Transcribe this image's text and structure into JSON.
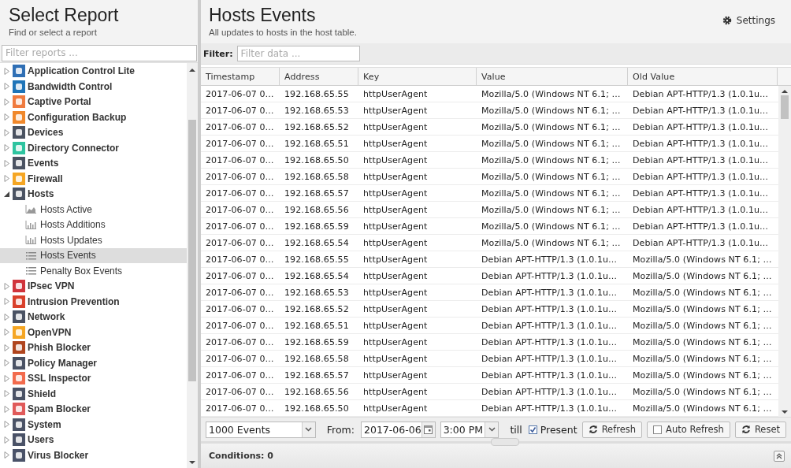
{
  "sidebar": {
    "title": "Select Report",
    "subtitle": "Find or select a report",
    "filter": {
      "placeholder": "Filter reports ..."
    },
    "tree": [
      {
        "label": "Application Control Lite",
        "color": "#2f6fb5",
        "expanded": false,
        "selected": false
      },
      {
        "label": "Bandwidth Control",
        "color": "#1e74b8",
        "expanded": false,
        "selected": false
      },
      {
        "label": "Captive Portal",
        "color": "#f07b3f",
        "expanded": false,
        "selected": false
      },
      {
        "label": "Configuration Backup",
        "color": "#f0882b",
        "expanded": false,
        "selected": false
      },
      {
        "label": "Devices",
        "color": "#4a5260",
        "expanded": false,
        "selected": false
      },
      {
        "label": "Directory Connector",
        "color": "#2ec4a0",
        "expanded": false,
        "selected": false
      },
      {
        "label": "Events",
        "color": "#4a5261",
        "expanded": false,
        "selected": false
      },
      {
        "label": "Firewall",
        "color": "#f5a623",
        "expanded": false,
        "selected": false
      },
      {
        "label": "Hosts",
        "color": "#4a5262",
        "expanded": true,
        "selected": false,
        "children": [
          {
            "label": "Hosts Active",
            "kind": "area",
            "selected": false
          },
          {
            "label": "Hosts Additions",
            "kind": "bars",
            "selected": false
          },
          {
            "label": "Hosts Updates",
            "kind": "bars",
            "selected": false
          },
          {
            "label": "Hosts Events",
            "kind": "list",
            "selected": true
          },
          {
            "label": "Penalty Box Events",
            "kind": "list",
            "selected": false
          }
        ]
      },
      {
        "label": "IPsec VPN",
        "color": "#d0343c",
        "expanded": false,
        "selected": false
      },
      {
        "label": "Intrusion Prevention",
        "color": "#d9402b",
        "expanded": false,
        "selected": false
      },
      {
        "label": "Network",
        "color": "#4a5263",
        "expanded": false,
        "selected": false
      },
      {
        "label": "OpenVPN",
        "color": "#f5a624",
        "expanded": false,
        "selected": false
      },
      {
        "label": "Phish Blocker",
        "color": "#b0451e",
        "expanded": false,
        "selected": false
      },
      {
        "label": "Policy Manager",
        "color": "#4a5264",
        "expanded": false,
        "selected": false
      },
      {
        "label": "SSL Inspector",
        "color": "#f26b4d",
        "expanded": false,
        "selected": false
      },
      {
        "label": "Shield",
        "color": "#4a5265",
        "expanded": false,
        "selected": false
      },
      {
        "label": "Spam Blocker",
        "color": "#e05a5a",
        "expanded": false,
        "selected": false
      },
      {
        "label": "System",
        "color": "#4a5266",
        "expanded": false,
        "selected": false
      },
      {
        "label": "Users",
        "color": "#4a5267",
        "expanded": false,
        "selected": false
      },
      {
        "label": "Virus Blocker",
        "color": "#4a5268",
        "expanded": false,
        "selected": false
      }
    ]
  },
  "main": {
    "title": "Hosts Events",
    "subtitle": "All updates to hosts in the host table.",
    "settings": "Settings",
    "filter": {
      "label": "Filter:",
      "placeholder": "Filter data ..."
    },
    "table": {
      "columns": [
        "Timestamp",
        "Address",
        "Key",
        "Value",
        "Old Value"
      ],
      "rows": [
        [
          "2017-06-07 0…",
          "192.168.65.55",
          "httpUserAgent",
          "Mozilla/5.0 (Windows NT 6.1; …",
          "Debian APT-HTTP/1.3 (1.0.1u…"
        ],
        [
          "2017-06-07 0…",
          "192.168.65.53",
          "httpUserAgent",
          "Mozilla/5.0 (Windows NT 6.1; …",
          "Debian APT-HTTP/1.3 (1.0.1u…"
        ],
        [
          "2017-06-07 0…",
          "192.168.65.52",
          "httpUserAgent",
          "Mozilla/5.0 (Windows NT 6.1; …",
          "Debian APT-HTTP/1.3 (1.0.1u…"
        ],
        [
          "2017-06-07 0…",
          "192.168.65.51",
          "httpUserAgent",
          "Mozilla/5.0 (Windows NT 6.1; …",
          "Debian APT-HTTP/1.3 (1.0.1u…"
        ],
        [
          "2017-06-07 0…",
          "192.168.65.50",
          "httpUserAgent",
          "Mozilla/5.0 (Windows NT 6.1; …",
          "Debian APT-HTTP/1.3 (1.0.1u…"
        ],
        [
          "2017-06-07 0…",
          "192.168.65.58",
          "httpUserAgent",
          "Mozilla/5.0 (Windows NT 6.1; …",
          "Debian APT-HTTP/1.3 (1.0.1u…"
        ],
        [
          "2017-06-07 0…",
          "192.168.65.57",
          "httpUserAgent",
          "Mozilla/5.0 (Windows NT 6.1; …",
          "Debian APT-HTTP/1.3 (1.0.1u…"
        ],
        [
          "2017-06-07 0…",
          "192.168.65.56",
          "httpUserAgent",
          "Mozilla/5.0 (Windows NT 6.1; …",
          "Debian APT-HTTP/1.3 (1.0.1u…"
        ],
        [
          "2017-06-07 0…",
          "192.168.65.59",
          "httpUserAgent",
          "Mozilla/5.0 (Windows NT 6.1; …",
          "Debian APT-HTTP/1.3 (1.0.1u…"
        ],
        [
          "2017-06-07 0…",
          "192.168.65.54",
          "httpUserAgent",
          "Mozilla/5.0 (Windows NT 6.1; …",
          "Debian APT-HTTP/1.3 (1.0.1u…"
        ],
        [
          "2017-06-07 0…",
          "192.168.65.55",
          "httpUserAgent",
          "Debian APT-HTTP/1.3 (1.0.1u…",
          "Mozilla/5.0 (Windows NT 6.1; …"
        ],
        [
          "2017-06-07 0…",
          "192.168.65.54",
          "httpUserAgent",
          "Debian APT-HTTP/1.3 (1.0.1u…",
          "Mozilla/5.0 (Windows NT 6.1; …"
        ],
        [
          "2017-06-07 0…",
          "192.168.65.53",
          "httpUserAgent",
          "Debian APT-HTTP/1.3 (1.0.1u…",
          "Mozilla/5.0 (Windows NT 6.1; …"
        ],
        [
          "2017-06-07 0…",
          "192.168.65.52",
          "httpUserAgent",
          "Debian APT-HTTP/1.3 (1.0.1u…",
          "Mozilla/5.0 (Windows NT 6.1; …"
        ],
        [
          "2017-06-07 0…",
          "192.168.65.51",
          "httpUserAgent",
          "Debian APT-HTTP/1.3 (1.0.1u…",
          "Mozilla/5.0 (Windows NT 6.1; …"
        ],
        [
          "2017-06-07 0…",
          "192.168.65.59",
          "httpUserAgent",
          "Debian APT-HTTP/1.3 (1.0.1u…",
          "Mozilla/5.0 (Windows NT 6.1; …"
        ],
        [
          "2017-06-07 0…",
          "192.168.65.58",
          "httpUserAgent",
          "Debian APT-HTTP/1.3 (1.0.1u…",
          "Mozilla/5.0 (Windows NT 6.1; …"
        ],
        [
          "2017-06-07 0…",
          "192.168.65.57",
          "httpUserAgent",
          "Debian APT-HTTP/1.3 (1.0.1u…",
          "Mozilla/5.0 (Windows NT 6.1; …"
        ],
        [
          "2017-06-07 0…",
          "192.168.65.56",
          "httpUserAgent",
          "Debian APT-HTTP/1.3 (1.0.1u…",
          "Mozilla/5.0 (Windows NT 6.1; …"
        ],
        [
          "2017-06-07 0…",
          "192.168.65.50",
          "httpUserAgent",
          "Debian APT-HTTP/1.3 (1.0.1u…",
          "Mozilla/5.0 (Windows NT 6.1; …"
        ]
      ]
    },
    "toolbar": {
      "limit": "1000 Events",
      "from_label": "From:",
      "date": "2017-06-06",
      "time": "3:00 PM",
      "till_label": "till",
      "present": {
        "label": "Present",
        "checked": true
      },
      "refresh": "Refresh",
      "auto_refresh": {
        "label": "Auto Refresh",
        "checked": false
      },
      "reset": "Reset"
    },
    "conditions": "Conditions: 0"
  }
}
